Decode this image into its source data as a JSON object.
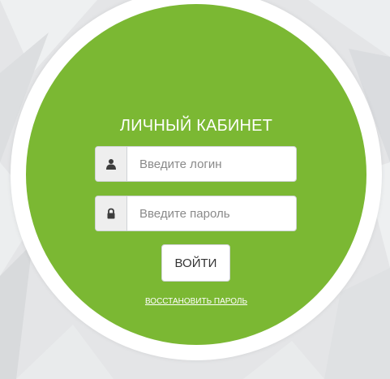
{
  "login_form": {
    "title": "ЛИЧНЫЙ КАБИНЕТ",
    "login_placeholder": "Введите логин",
    "password_placeholder": "Введите пароль",
    "submit_label": "ВОЙТИ",
    "restore_link": "ВОССТАНОВИТЬ ПАРОЛЬ"
  },
  "icons": {
    "login": "user-icon",
    "password": "lock-icon"
  },
  "colors": {
    "accent": "#7bb833",
    "ring": "#ffffff",
    "background": "#e6e7e9"
  }
}
